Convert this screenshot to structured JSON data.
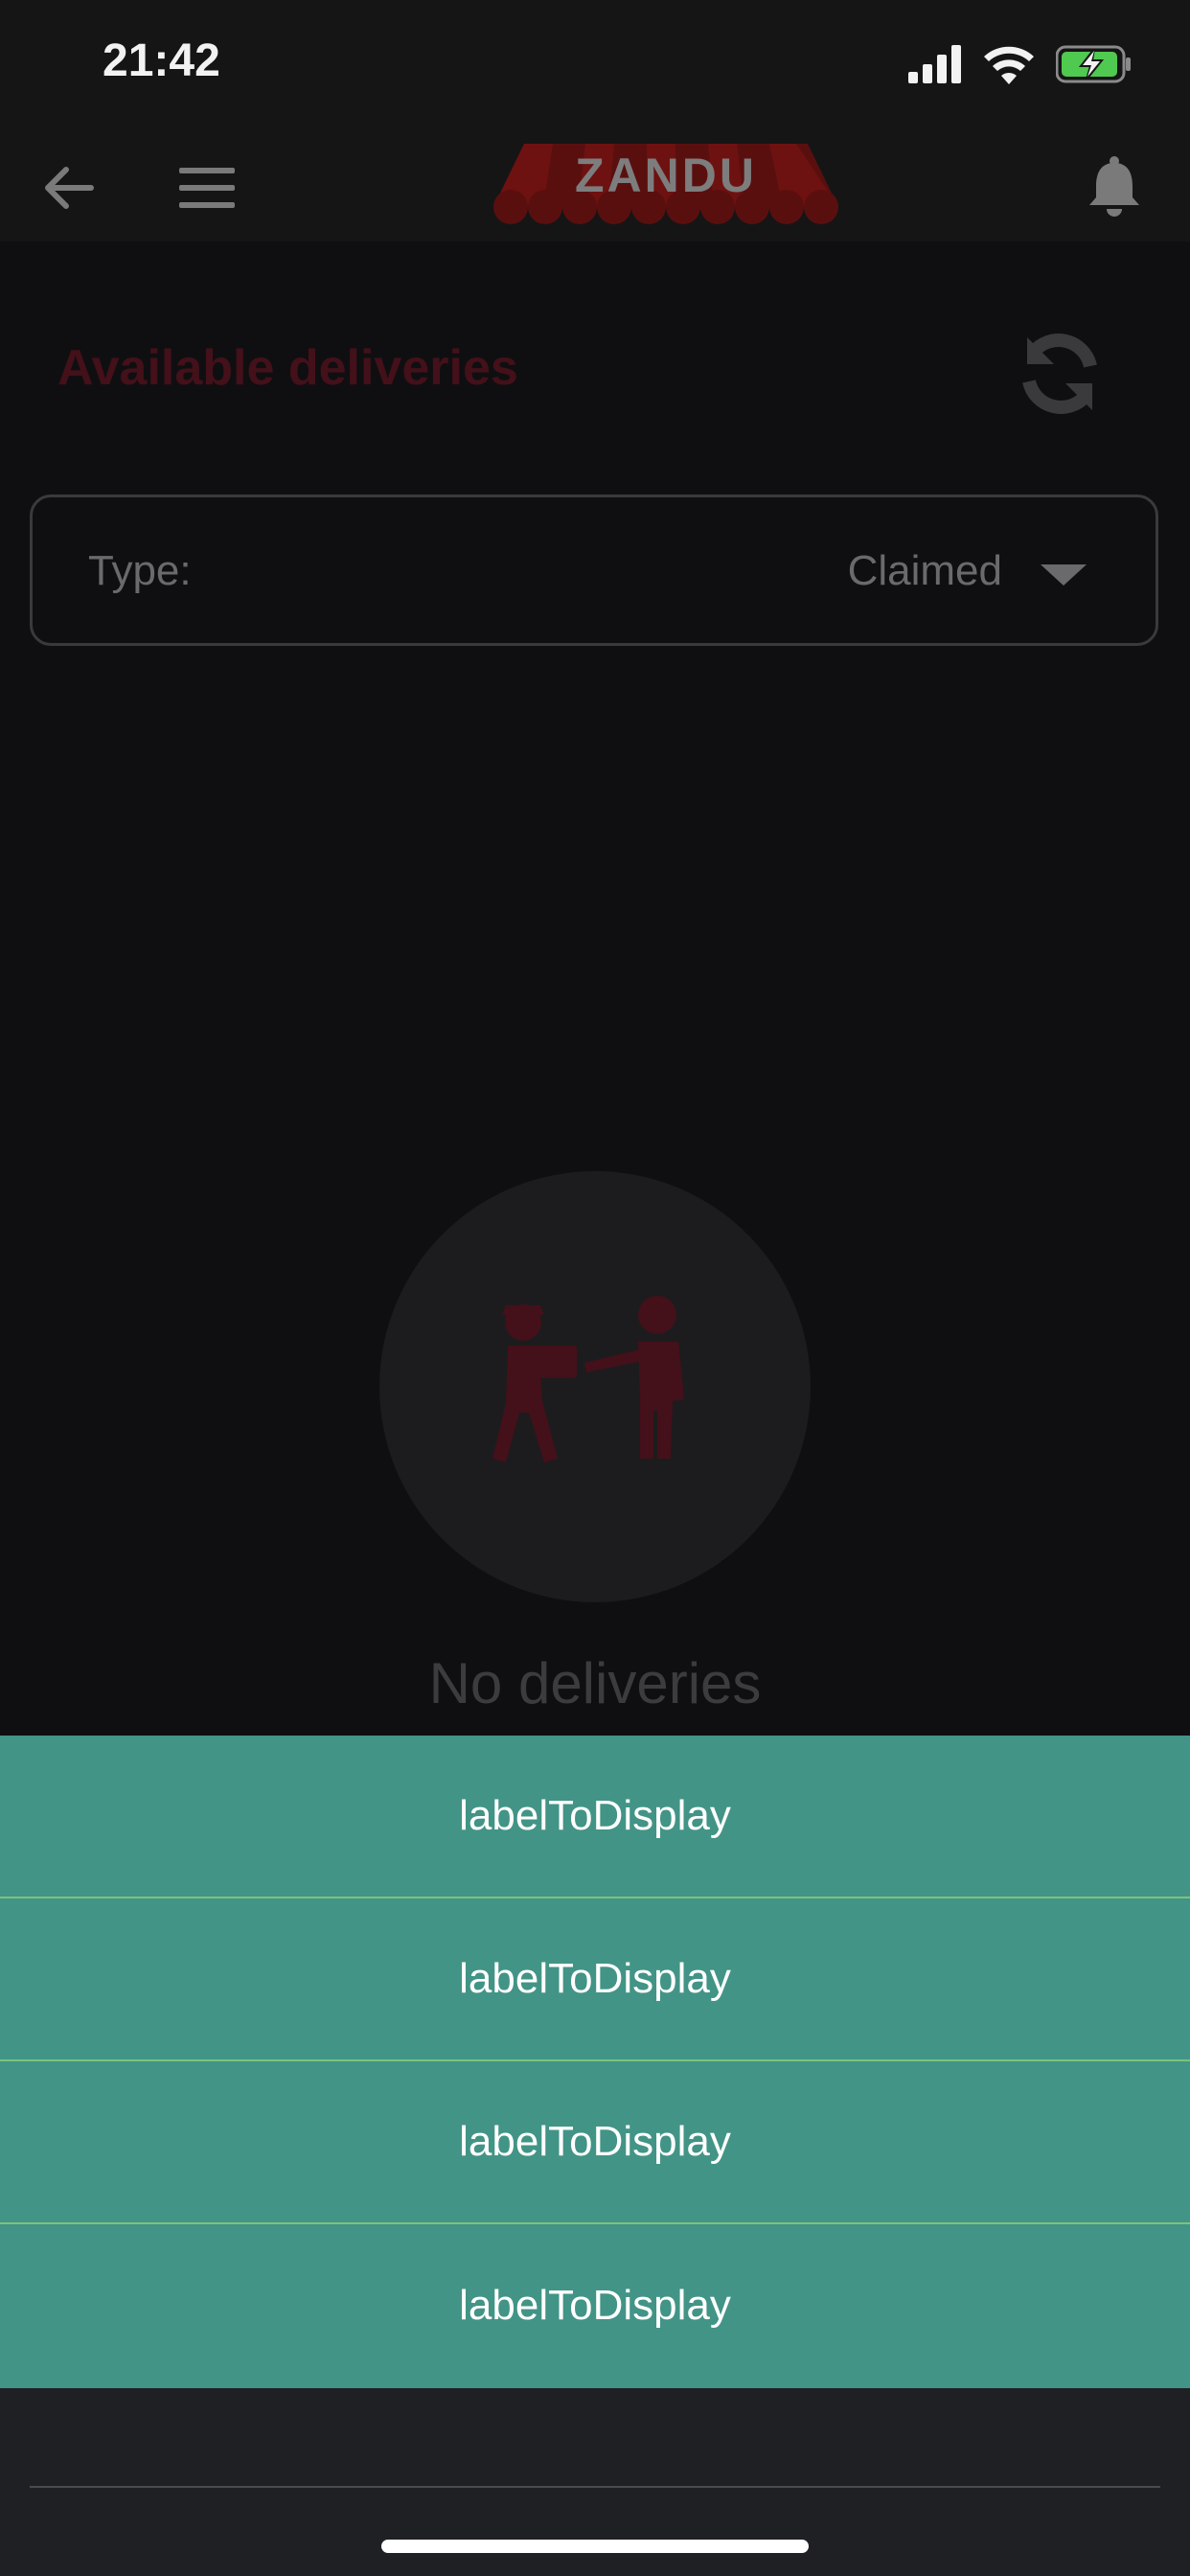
{
  "status_bar": {
    "time": "21:42"
  },
  "header": {
    "logo_text": "ZANDU"
  },
  "page": {
    "title": "Available deliveries",
    "type_label": "Type:",
    "type_value": "Claimed",
    "empty_message": "No deliveries"
  },
  "action_sheet": {
    "items": [
      {
        "label": "labelToDisplay"
      },
      {
        "label": "labelToDisplay"
      },
      {
        "label": "labelToDisplay"
      },
      {
        "label": "labelToDisplay"
      }
    ]
  },
  "colors": {
    "accent_dim": "#44101a",
    "sheet_bg": "#429486",
    "sheet_divider": "#7cc37c",
    "battery_green": "#4fc94f"
  },
  "icons": {
    "back": "arrow-left-icon",
    "menu": "hamburger-menu-icon",
    "notifications": "bell-icon",
    "refresh": "refresh-icon",
    "dropdown": "caret-down-icon",
    "empty_state": "delivery-handoff-icon"
  }
}
